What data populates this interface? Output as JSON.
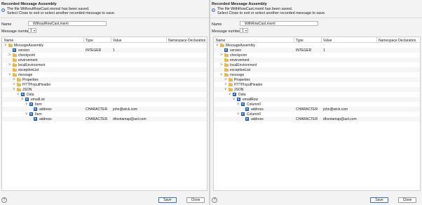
{
  "left": {
    "title": "Recorded Message Assembly",
    "info_line1": "The file WithoutRowCast.msmsl has been saved.",
    "info_line2": "Select Close to exit or select another recorded message to save.",
    "name_label": "Name",
    "name_value": "WithoutRowCast.msml",
    "msg_label": "Message number",
    "msg_value": "1",
    "columns": [
      "Name",
      "Type",
      "Value",
      "Namespace Declaration"
    ],
    "rows": [
      {
        "name": "MessageAssembly",
        "type": "",
        "value": "",
        "icon": "folder-icon",
        "twisty": "∨"
      },
      {
        "name": "version",
        "type": "INTEGER",
        "value": "1",
        "icon": "element-icon",
        "twisty": ""
      },
      {
        "name": "checkpoint",
        "type": "",
        "value": "",
        "icon": "folder-icon",
        "twisty": ">"
      },
      {
        "name": "environment",
        "type": "",
        "value": "",
        "icon": "folder-icon",
        "twisty": ""
      },
      {
        "name": "localEnvironment",
        "type": "",
        "value": "",
        "icon": "folder-icon",
        "twisty": ">"
      },
      {
        "name": "exceptionList",
        "type": "",
        "value": "",
        "icon": "folder-icon",
        "twisty": ""
      },
      {
        "name": "message",
        "type": "",
        "value": "",
        "icon": "folder-icon",
        "twisty": "∨"
      },
      {
        "name": "Properties",
        "type": "",
        "value": "",
        "icon": "folder-icon",
        "twisty": ">"
      },
      {
        "name": "HTTPInputHeader",
        "type": "",
        "value": "",
        "icon": "folder-icon",
        "twisty": ">"
      },
      {
        "name": "JSON",
        "type": "",
        "value": "",
        "icon": "folder-icon",
        "twisty": "∨"
      },
      {
        "name": "Data",
        "type": "",
        "value": "",
        "icon": "element-icon",
        "twisty": "∨"
      },
      {
        "name": "emailList",
        "type": "",
        "value": "",
        "icon": "element-icon",
        "twisty": "∨"
      },
      {
        "name": "Item",
        "type": "",
        "value": "",
        "icon": "element-icon",
        "twisty": "∨"
      },
      {
        "name": "address",
        "type": "CHARACTER",
        "value": "john@wick.com",
        "icon": "element-icon",
        "twisty": ""
      },
      {
        "name": "Item",
        "type": "",
        "value": "",
        "icon": "element-icon",
        "twisty": "∨"
      },
      {
        "name": "address",
        "type": "CHARACTER",
        "value": "dhootamap@aol.com",
        "icon": "element-icon",
        "twisty": ""
      }
    ],
    "save_label": "Save",
    "close_label": "Close",
    "help_label": "?"
  },
  "right": {
    "title": "Recorded Message Assembly",
    "info_line1": "The file WithRowCast.msml has been saved.",
    "info_line2": "Select Close to exit or select another recorded message to save.",
    "name_label": "Name",
    "name_value": "WithRowCast.msml",
    "msg_label": "Message number",
    "msg_value": "1",
    "columns": [
      "Name",
      "Type",
      "Value",
      "Namespace Declaration"
    ],
    "rows": [
      {
        "name": "MessageAssembly",
        "type": "",
        "value": "",
        "icon": "folder-icon",
        "twisty": "∨"
      },
      {
        "name": "version",
        "type": "INTEGER",
        "value": "1",
        "icon": "element-icon",
        "twisty": ""
      },
      {
        "name": "checkpoint",
        "type": "",
        "value": "",
        "icon": "folder-icon",
        "twisty": ">"
      },
      {
        "name": "environment",
        "type": "",
        "value": "",
        "icon": "folder-icon",
        "twisty": ""
      },
      {
        "name": "localEnvironment",
        "type": "",
        "value": "",
        "icon": "folder-icon",
        "twisty": ">"
      },
      {
        "name": "exceptionList",
        "type": "",
        "value": "",
        "icon": "folder-icon",
        "twisty": ""
      },
      {
        "name": "message",
        "type": "",
        "value": "",
        "icon": "folder-icon",
        "twisty": "∨"
      },
      {
        "name": "Properties",
        "type": "",
        "value": "",
        "icon": "folder-icon",
        "twisty": ">"
      },
      {
        "name": "HTTPInputHeader",
        "type": "",
        "value": "",
        "icon": "folder-icon",
        "twisty": ">"
      },
      {
        "name": "JSON",
        "type": "",
        "value": "",
        "icon": "folder-icon",
        "twisty": "∨"
      },
      {
        "name": "Data",
        "type": "",
        "value": "",
        "icon": "element-icon",
        "twisty": "∨"
      },
      {
        "name": "emailRow",
        "type": "",
        "value": "",
        "icon": "element-icon",
        "twisty": "∨"
      },
      {
        "name": "Column0",
        "type": "",
        "value": "",
        "icon": "element-icon",
        "twisty": "∨"
      },
      {
        "name": "address",
        "type": "CHARACTER",
        "value": "john@wick.com",
        "icon": "element-icon",
        "twisty": ""
      },
      {
        "name": "Column0",
        "type": "",
        "value": "",
        "icon": "element-icon",
        "twisty": "∨"
      },
      {
        "name": "address",
        "type": "CHARACTER",
        "value": "dhootamap@aol.com",
        "icon": "element-icon",
        "twisty": ""
      }
    ],
    "save_label": "Save",
    "close_label": "Close",
    "help_label": "?"
  },
  "colors": {
    "folder": "#e8b84a",
    "element": "#3c7dd9",
    "accent": "#2e6fd8"
  }
}
